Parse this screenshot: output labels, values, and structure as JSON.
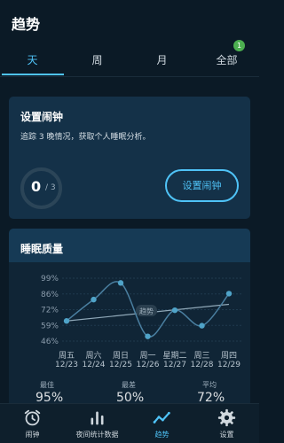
{
  "header": {
    "title": "趋势"
  },
  "tabs": [
    {
      "label": "天",
      "active": true
    },
    {
      "label": "周",
      "active": false
    },
    {
      "label": "月",
      "active": false
    },
    {
      "label": "全部",
      "active": false,
      "badge": "1"
    }
  ],
  "alarm_card": {
    "title": "设置闹钟",
    "description": "追踪 3 晚情况，获取个人睡眠分析。",
    "progress_count": "0",
    "progress_total": "/ 3",
    "button_label": "设置闹钟"
  },
  "quality_card": {
    "title": "睡眠质量",
    "trend_label": "趋势",
    "stats": [
      {
        "label": "最佳",
        "value": "95%"
      },
      {
        "label": "最差",
        "value": "50%"
      },
      {
        "label": "平均",
        "value": "72%"
      }
    ]
  },
  "chart_data": {
    "type": "line",
    "y_ticks": [
      "99%",
      "86%",
      "72%",
      "59%",
      "46%"
    ],
    "ylim": [
      46,
      99
    ],
    "categories": [
      {
        "day": "周五",
        "date": "12/23"
      },
      {
        "day": "周六",
        "date": "12/24"
      },
      {
        "day": "周日",
        "date": "12/25"
      },
      {
        "day": "周一",
        "date": "12/26"
      },
      {
        "day": "星期二",
        "date": "12/27"
      },
      {
        "day": "周三",
        "date": "12/28"
      },
      {
        "day": "周四",
        "date": "12/29"
      }
    ],
    "series": [
      {
        "values": [
          63,
          81,
          95,
          50,
          72,
          59,
          86
        ]
      }
    ],
    "trend": [
      63,
      77
    ]
  },
  "bottom_nav": [
    {
      "label": "闹钟",
      "icon": "alarm-clock-icon",
      "active": false
    },
    {
      "label": "夜间统计数据",
      "icon": "bar-chart-icon",
      "active": false
    },
    {
      "label": "趋势",
      "icon": "trend-icon",
      "active": true
    },
    {
      "label": "设置",
      "icon": "gear-icon",
      "active": false
    }
  ],
  "colors": {
    "accent": "#4fc3f7",
    "badge": "#4caf50",
    "background": "#0b1a26"
  }
}
